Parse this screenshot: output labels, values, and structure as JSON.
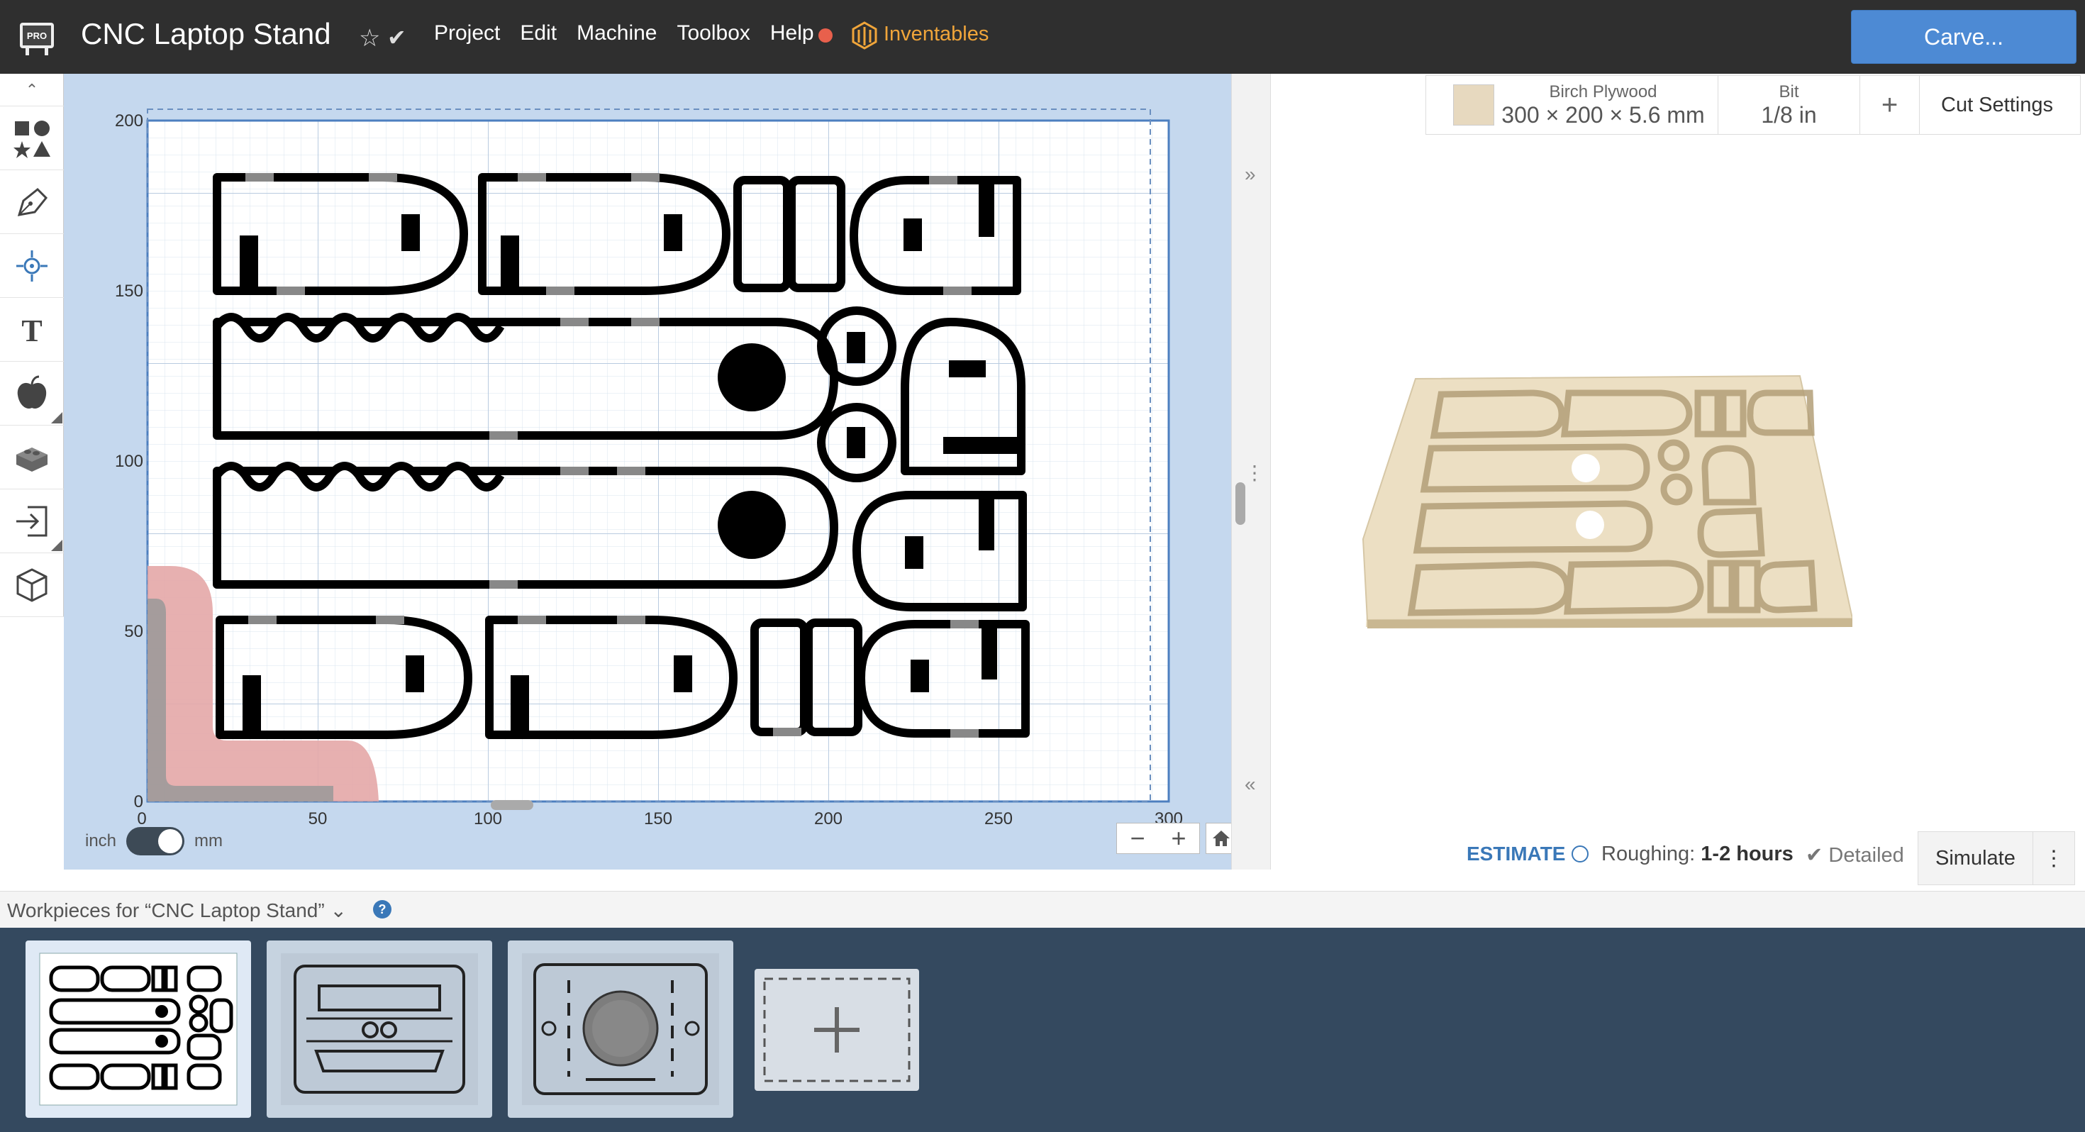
{
  "header": {
    "app_badge": "PRO",
    "title": "CNC Laptop Stand",
    "menu": [
      "Project",
      "Edit",
      "Machine",
      "Toolbox",
      "Help"
    ],
    "brand": "Inventables",
    "carve_label": "Carve..."
  },
  "tools": [
    "collapse-icon",
    "shapes-icon",
    "pen-icon",
    "target-icon",
    "text-icon",
    "apple-icon",
    "lego-icon",
    "import-icon",
    "cube-icon"
  ],
  "canvas": {
    "x_ticks": [
      "0",
      "50",
      "100",
      "150",
      "200",
      "250",
      "300"
    ],
    "y_ticks": [
      "200",
      "150",
      "100",
      "50",
      "0"
    ],
    "unit_left": "inch",
    "unit_right": "mm",
    "zoom_minus": "−",
    "zoom_plus": "+"
  },
  "material": {
    "name": "Birch Plywood",
    "dims": "300 × 200 × 5.6 mm",
    "bit_label": "Bit",
    "bit_value": "1/8 in",
    "add": "+",
    "cut_settings": "Cut Settings"
  },
  "estimate": {
    "label": "ESTIMATE",
    "roughing_label": "Roughing:",
    "roughing_value": "1-2 hours",
    "detailed": "Detailed",
    "simulate": "Simulate",
    "more": "⋮"
  },
  "workpieces": {
    "header": "Workpieces for “CNC Laptop Stand”",
    "help": "?"
  },
  "colors": {
    "topbar": "#2f2f2f",
    "accent": "#4d8ad4",
    "brand": "#f0a53a",
    "canvas_bg": "#c5d8ee",
    "tray": "#34495f"
  }
}
